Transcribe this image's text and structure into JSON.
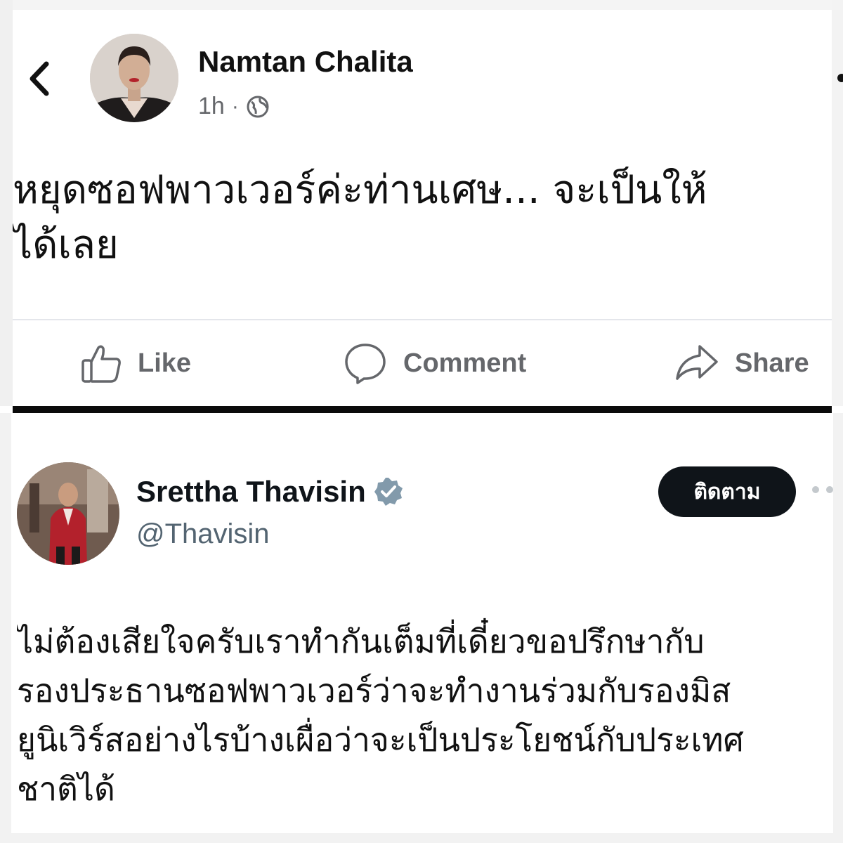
{
  "facebook_post": {
    "author": "Namtan Chalita",
    "time": "1h",
    "visibility_icon": "globe-icon",
    "text_lines": [
      "หยุดซอฟพาวเวอร์ค่ะท่านเศษ... จะเป็นให้",
      "ได้เลย"
    ],
    "actions": {
      "like": "Like",
      "comment": "Comment",
      "share": "Share"
    }
  },
  "twitter_post": {
    "author": "Srettha Thavisin",
    "handle": "@Thavisin",
    "verified_icon": "verified-badge-icon",
    "follow_label": "ติดตาม",
    "text_lines": [
      "ไม่ต้องเสียใจครับเราทำกันเต็มที่เดี๋ยวขอปรึกษากับ",
      "รองประธานซอฟพาวเวอร์ว่าจะทำงานร่วมกับรองมิส",
      "ยูนิเวิร์สอย่างไรบ้างเผื่อว่าจะเป็นประโยชน์กับประเทศ",
      "ชาติได้"
    ]
  },
  "colors": {
    "fb_secondary": "#65676b",
    "tw_secondary": "#536471",
    "follow_bg": "#0f1419",
    "separator": "#0b0b0b"
  }
}
